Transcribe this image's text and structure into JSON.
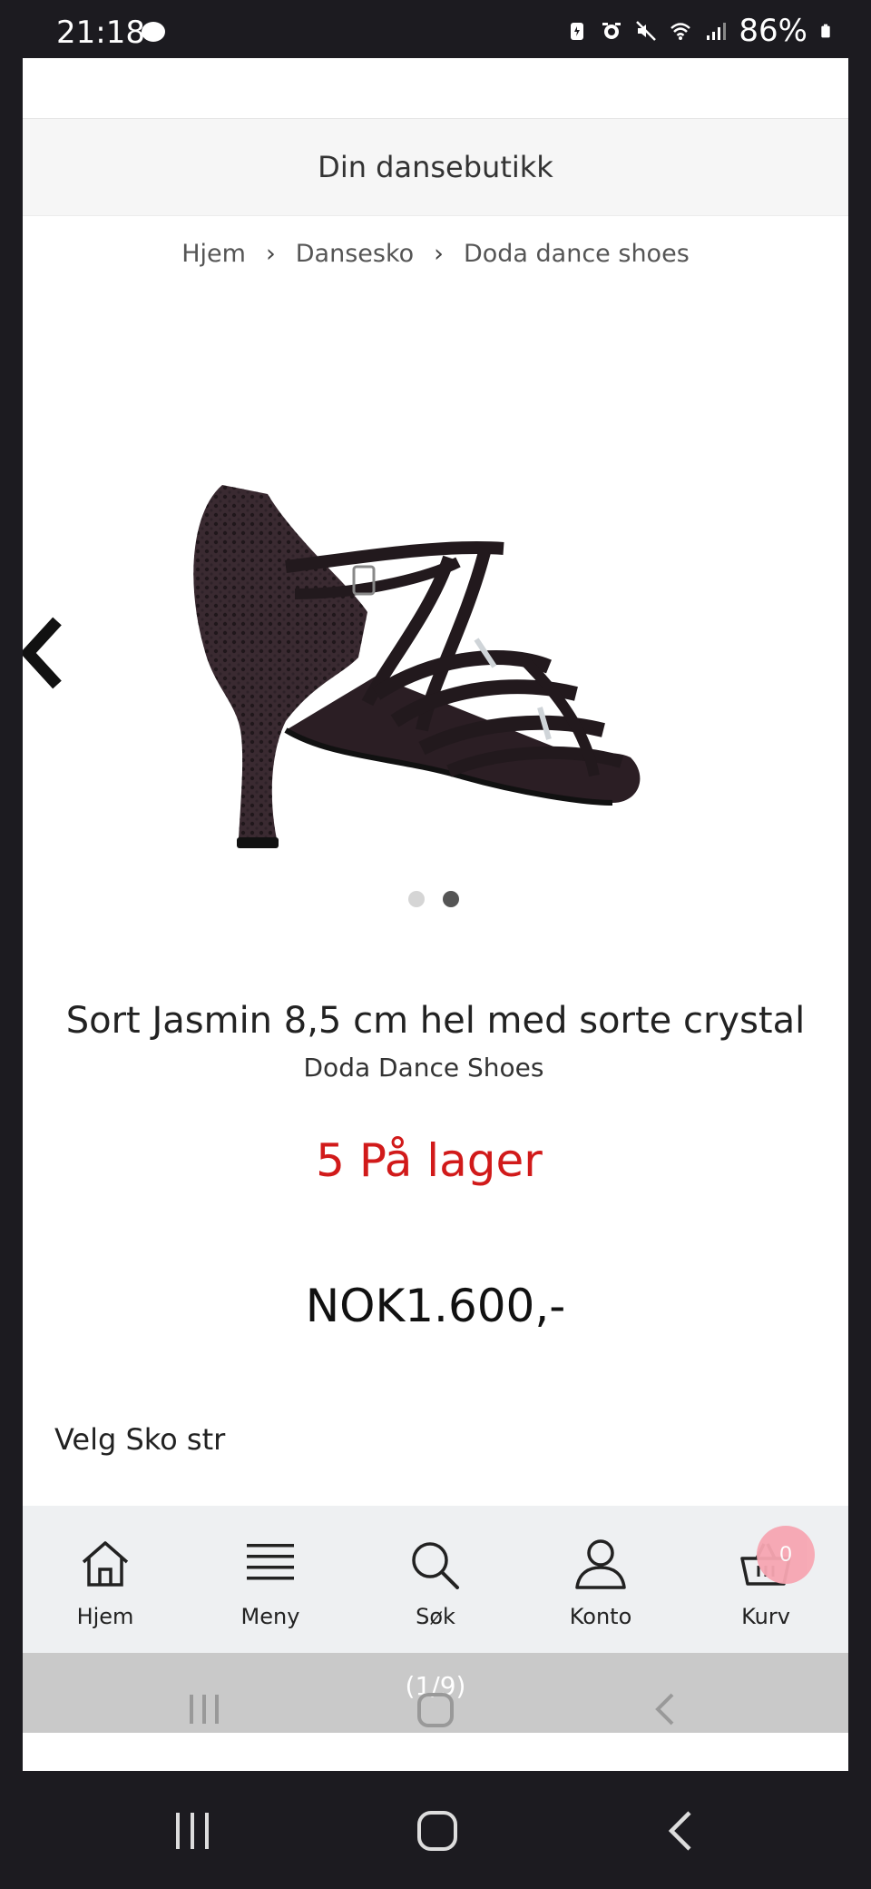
{
  "status_bar": {
    "time": "21:18",
    "battery": "86%"
  },
  "store": {
    "banner": "Din dansebutikk"
  },
  "breadcrumb": [
    "Hjem",
    "Dansesko",
    "Doda dance shoes"
  ],
  "gallery": {
    "dots": 2,
    "active_dot": 2
  },
  "product": {
    "title": "Sort Jasmin 8,5 cm hel med sorte crystal",
    "brand": "Doda Dance Shoes",
    "stock": "5 På lager",
    "price": "NOK1.600,-",
    "size_label": "Velg Sko str"
  },
  "bottom_nav": [
    {
      "label": "Hjem",
      "icon": "home-icon"
    },
    {
      "label": "Meny",
      "icon": "menu-icon"
    },
    {
      "label": "Søk",
      "icon": "search-icon"
    },
    {
      "label": "Konto",
      "icon": "user-icon"
    },
    {
      "label": "Kurv",
      "icon": "cart-icon"
    }
  ],
  "cart": {
    "count": "0"
  },
  "overlay": {
    "counter": "(1/9)"
  },
  "colors": {
    "stock_red": "#d11a1a",
    "badge_pink": "#f7a6b2"
  }
}
